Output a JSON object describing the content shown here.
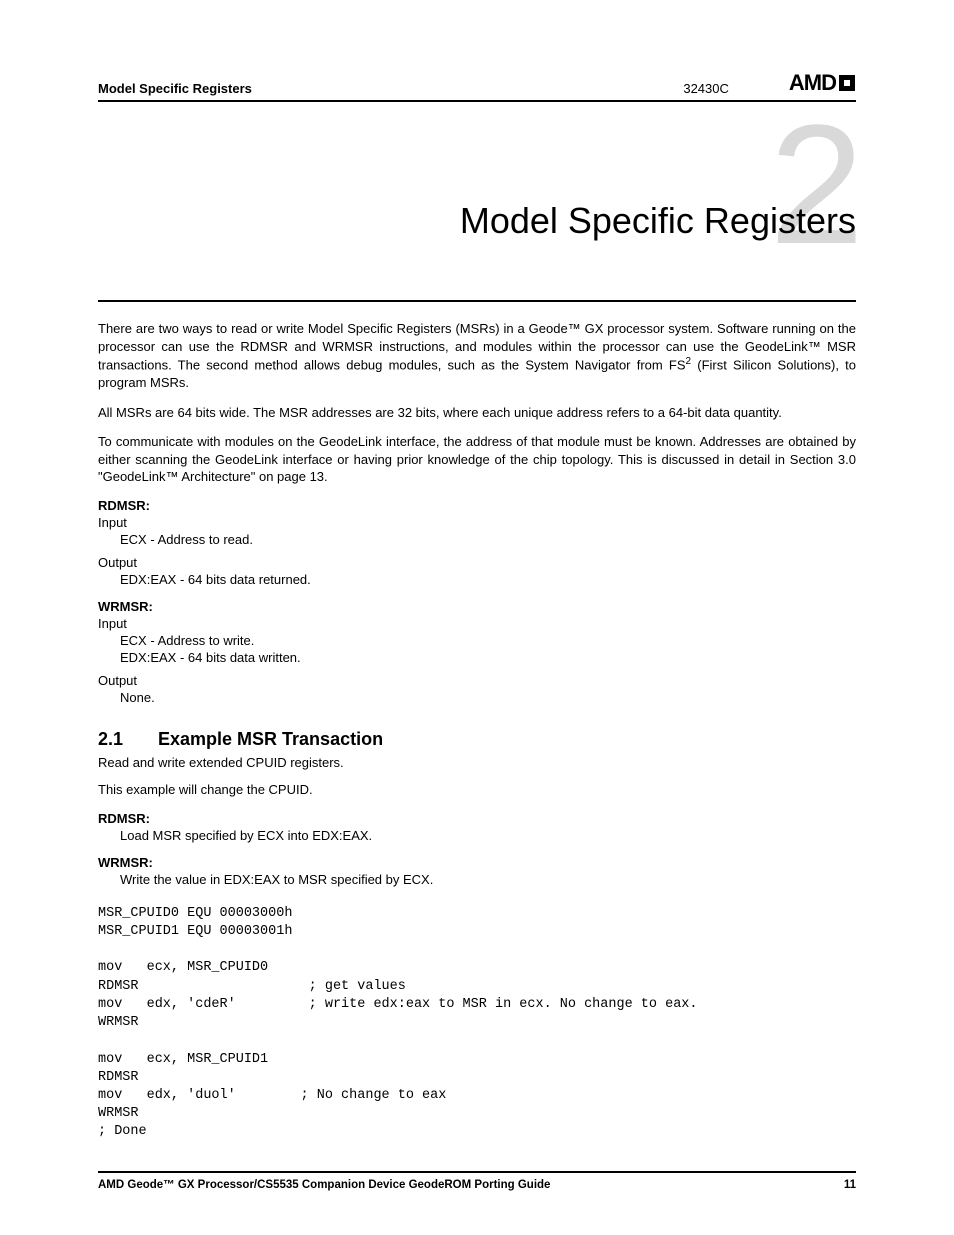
{
  "header": {
    "section": "Model Specific Registers",
    "doc_id": "32430C",
    "logo_text": "AMD"
  },
  "chapter": {
    "number": "2",
    "title": "Model Specific Registers"
  },
  "paragraphs": {
    "p1a": "There are two ways to read or write Model Specific Registers (MSRs) in a Geode™ GX processor system. Software running on the processor can use the RDMSR and WRMSR instructions, and modules within the processor can use the GeodeLink™ MSR transactions. The second method allows debug modules, such as the System Navigator from FS",
    "p1sup": "2",
    "p1b": " (First Silicon Solutions), to program MSRs.",
    "p2": "All MSRs are 64 bits wide. The MSR addresses are 32 bits, where each unique address refers to a 64-bit data quantity.",
    "p3": "To communicate with modules on the GeodeLink interface, the address of that module must be known. Addresses are obtained by either scanning the GeodeLink interface or having prior knowledge of the chip topology. This is discussed in detail in Section 3.0 \"GeodeLink™ Architecture\" on page 13."
  },
  "rdmsr": {
    "label": "RDMSR:",
    "input_label": "Input",
    "input_line": "ECX - Address to read.",
    "output_label": "Output",
    "output_line": "EDX:EAX - 64 bits data returned."
  },
  "wrmsr": {
    "label": "WRMSR:",
    "input_label": "Input",
    "input_line1": "ECX - Address to write.",
    "input_line2": "EDX:EAX - 64 bits data written.",
    "output_label": "Output",
    "output_line": "None."
  },
  "section21": {
    "num": "2.1",
    "title": "Example MSR Transaction",
    "p1": "Read and write extended CPUID registers.",
    "p2": "This example will change the CPUID.",
    "rdmsr_label": "RDMSR:",
    "rdmsr_text": "Load MSR specified by ECX into EDX:EAX.",
    "wrmsr_label": "WRMSR:",
    "wrmsr_text": "Write the value in EDX:EAX to MSR specified by ECX."
  },
  "code": "MSR_CPUID0 EQU 00003000h\nMSR_CPUID1 EQU 00003001h\n\nmov   ecx, MSR_CPUID0\nRDMSR                     ; get values\nmov   edx, 'cdeR'         ; write edx:eax to MSR in ecx. No change to eax.\nWRMSR\n\nmov   ecx, MSR_CPUID1\nRDMSR\nmov   edx, 'duol'        ; No change to eax\nWRMSR\n; Done",
  "footer": {
    "left": "AMD Geode™ GX Processor/CS5535 Companion Device GeodeROM Porting Guide",
    "right": "11"
  }
}
